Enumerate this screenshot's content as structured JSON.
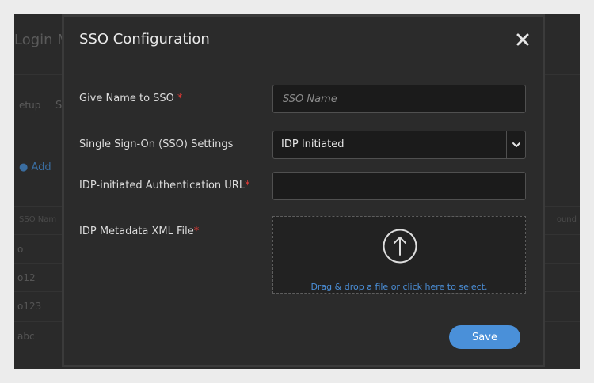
{
  "background": {
    "title": "Login M",
    "tab1": "etup",
    "tab2": "S",
    "add_button": "Add",
    "column_header_1": "SSO Nam",
    "column_header_2": "ound",
    "rows": [
      "o",
      "o12",
      "o123",
      "abc"
    ]
  },
  "modal": {
    "title": "SSO Configuration",
    "close_symbol": "✕",
    "fields": {
      "name": {
        "label": "Give Name to SSO ",
        "required": "*",
        "placeholder": "SSO Name",
        "value": ""
      },
      "settings": {
        "label": "Single Sign-On (SSO) Settings",
        "selected": "IDP Initiated"
      },
      "url": {
        "label": "IDP-initiated Authentication URL",
        "required": "*",
        "value": ""
      },
      "metadata": {
        "label": "IDP Metadata XML File",
        "required": "*",
        "drop_text": "Drag & drop a file or click here to select."
      }
    },
    "save_label": "Save"
  },
  "colors": {
    "accent": "#4a90d9",
    "required": "#e53935",
    "link": "#4b8fd8"
  },
  "icons": {
    "close": "close-icon",
    "chevron": "chevron-down-icon",
    "upload": "upload-arrow-icon",
    "add": "plus-circle-icon"
  }
}
